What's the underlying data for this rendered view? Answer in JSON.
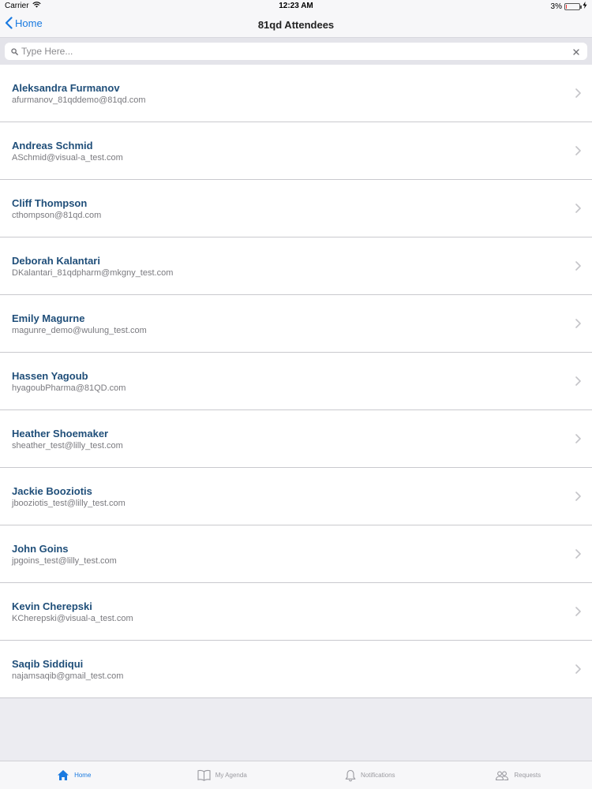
{
  "status_bar": {
    "carrier": "Carrier",
    "time": "12:23 AM",
    "battery": "3%"
  },
  "nav": {
    "back_label": "Home",
    "title": "81qd Attendees"
  },
  "search": {
    "placeholder": "Type Here...",
    "value": ""
  },
  "attendees": [
    {
      "name": "Aleksandra Furmanov",
      "email": "afurmanov_81qddemo@81qd.com"
    },
    {
      "name": "Andreas Schmid",
      "email": "ASchmid@visual-a_test.com"
    },
    {
      "name": "Cliff Thompson",
      "email": "cthompson@81qd.com"
    },
    {
      "name": "Deborah Kalantari",
      "email": "DKalantari_81qdpharm@mkgny_test.com"
    },
    {
      "name": "Emily Magurne",
      "email": "magunre_demo@wulung_test.com"
    },
    {
      "name": "Hassen Yagoub",
      "email": "hyagoubPharma@81QD.com"
    },
    {
      "name": "Heather Shoemaker",
      "email": "sheather_test@lilly_test.com"
    },
    {
      "name": "Jackie Booziotis",
      "email": "jbooziotis_test@lilly_test.com"
    },
    {
      "name": "John Goins",
      "email": "jpgoins_test@lilly_test.com"
    },
    {
      "name": "Kevin Cherepski",
      "email": "KCherepski@visual-a_test.com"
    },
    {
      "name": "Saqib Siddiqui",
      "email": "najamsaqib@gmail_test.com"
    }
  ],
  "tabs": [
    {
      "label": "Home",
      "icon": "home-icon",
      "active": true
    },
    {
      "label": "My Agenda",
      "icon": "book-icon",
      "active": false
    },
    {
      "label": "Notifications",
      "icon": "bell-icon",
      "active": false
    },
    {
      "label": "Requests",
      "icon": "people-icon",
      "active": false
    }
  ],
  "colors": {
    "accent": "#1a7ae0",
    "name_text": "#1f4e79",
    "battery_low": "#ee3333"
  }
}
